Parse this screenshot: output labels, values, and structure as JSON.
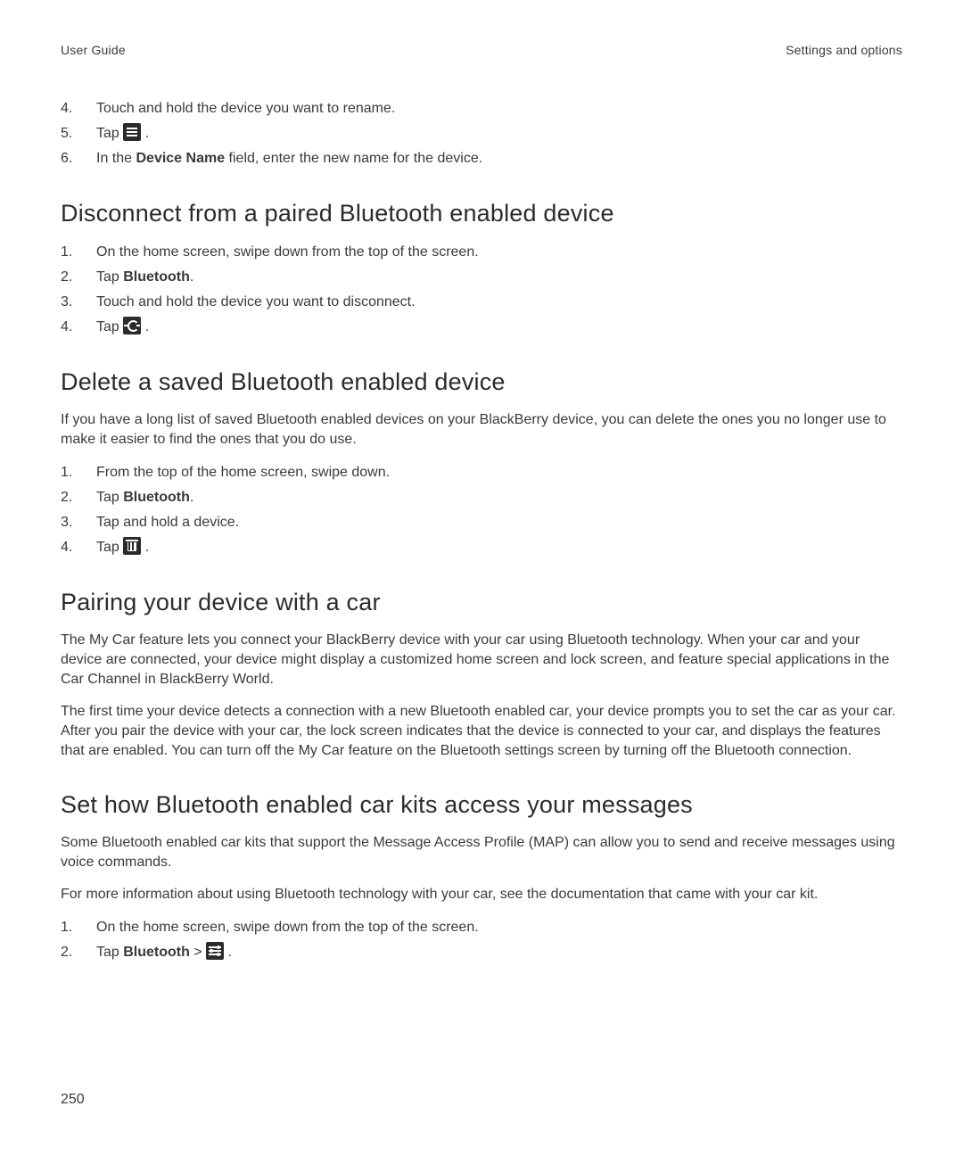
{
  "header": {
    "left": "User Guide",
    "right": "Settings and options"
  },
  "intro_steps": [
    {
      "num": "4.",
      "text": "Touch and hold the device you want to rename."
    },
    {
      "num": "5.",
      "prefix": "Tap ",
      "icon": "menu",
      "suffix": " ."
    },
    {
      "num": "6.",
      "prefix": "In the ",
      "bold": "Device Name",
      "suffix": " field, enter the new name for the device."
    }
  ],
  "sections": {
    "disconnect": {
      "heading": "Disconnect from a paired Bluetooth enabled device",
      "steps": [
        {
          "num": "1.",
          "text": "On the home screen, swipe down from the top of the screen."
        },
        {
          "num": "2.",
          "prefix": "Tap ",
          "bold": "Bluetooth",
          "suffix": "."
        },
        {
          "num": "3.",
          "text": "Touch and hold the device you want to disconnect."
        },
        {
          "num": "4.",
          "prefix": "Tap ",
          "icon": "disconnect",
          "suffix": " ."
        }
      ]
    },
    "delete": {
      "heading": "Delete a saved Bluetooth enabled device",
      "para": "If you have a long list of saved Bluetooth enabled devices on your BlackBerry device, you can delete the ones you no longer use to make it easier to find the ones that you do use.",
      "steps": [
        {
          "num": "1.",
          "text": "From the top of the home screen, swipe down."
        },
        {
          "num": "2.",
          "prefix": "Tap ",
          "bold": "Bluetooth",
          "suffix": "."
        },
        {
          "num": "3.",
          "text": "Tap and hold a device."
        },
        {
          "num": "4.",
          "prefix": "Tap ",
          "icon": "trash",
          "suffix": " ."
        }
      ]
    },
    "pairing": {
      "heading": "Pairing your device with a car",
      "para1": "The My Car feature lets you connect your BlackBerry device with your car using Bluetooth technology. When your car and your device are connected, your device might display a customized home screen and lock screen, and feature special applications in the Car Channel in BlackBerry World.",
      "para2": "The first time your device detects a connection with a new Bluetooth enabled car, your device prompts you to set the car as your car. After you pair the device with your car, the lock screen indicates that the device is connected to your car, and displays the features that are enabled. You can turn off the My Car feature on the Bluetooth settings screen by turning off the Bluetooth connection."
    },
    "carkits": {
      "heading": "Set how Bluetooth enabled car kits access your messages",
      "para1": "Some Bluetooth enabled car kits that support the Message Access Profile (MAP) can allow you to send and receive messages using voice commands.",
      "para2": "For more information about using Bluetooth technology with your car, see the documentation that came with your car kit.",
      "steps": [
        {
          "num": "1.",
          "text": "On the home screen, swipe down from the top of the screen."
        },
        {
          "num": "2.",
          "prefix": "Tap ",
          "bold": "Bluetooth",
          "mid": " > ",
          "icon": "sliders",
          "suffix": " ."
        }
      ]
    }
  },
  "page_number": "250"
}
